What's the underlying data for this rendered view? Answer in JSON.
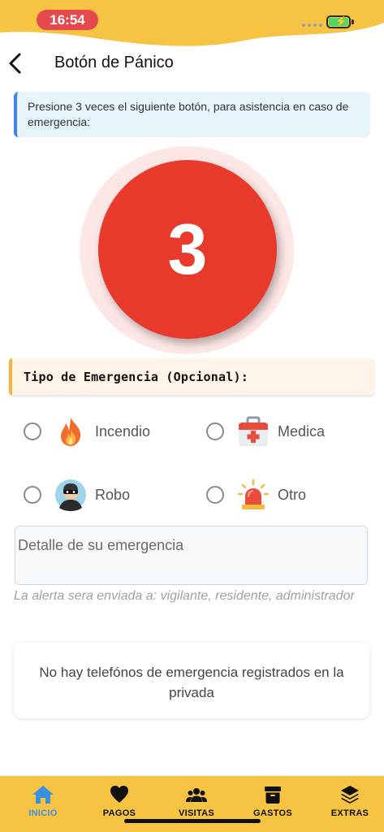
{
  "status_bar": {
    "time": "16:54",
    "accent_color": "#f6c342",
    "time_pill_color": "#e5484d",
    "battery_icon": "battery-charging-icon"
  },
  "header": {
    "back_icon": "chevron-left-icon",
    "title": "Botón de Pánico"
  },
  "info": {
    "text": "Presione 3 veces el siguiente botón, para asistencia en caso de emergencia:"
  },
  "panic_button": {
    "count": "3",
    "color": "#e83a2b"
  },
  "emergency_type": {
    "title": "Tipo de Emergencia (Opcional):",
    "options": [
      {
        "label": "Incendio",
        "icon": "fire-icon",
        "selected": false
      },
      {
        "label": "Medica",
        "icon": "first-aid-kit-icon",
        "selected": false
      },
      {
        "label": "Robo",
        "icon": "thief-icon",
        "selected": false
      },
      {
        "label": "Otro",
        "icon": "alarm-siren-icon",
        "selected": false
      }
    ]
  },
  "detail": {
    "placeholder": "Detalle de su emergencia",
    "value": ""
  },
  "alert_note": "La alerta sera enviada a: vigilante, residente, administrador",
  "phones_message": "No hay telefónos de emergencia registrados en la privada",
  "bottom_nav": {
    "items": [
      {
        "label": "INICIO",
        "icon": "home-icon",
        "active": true
      },
      {
        "label": "PAGOS",
        "icon": "heart-icon",
        "active": false
      },
      {
        "label": "VISITAS",
        "icon": "people-icon",
        "active": false
      },
      {
        "label": "GASTOS",
        "icon": "archive-box-icon",
        "active": false
      },
      {
        "label": "EXTRAS",
        "icon": "layers-icon",
        "active": false
      }
    ],
    "active_color": "#3b8fe0"
  }
}
